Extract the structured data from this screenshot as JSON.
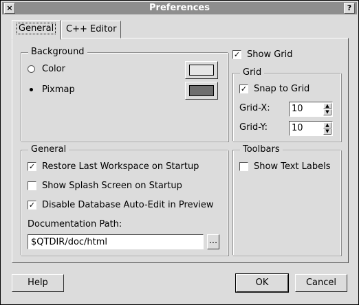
{
  "window": {
    "title": "Preferences",
    "close_glyph": "×",
    "help_glyph": "?"
  },
  "tabs": [
    {
      "label": "General",
      "active": true
    },
    {
      "label": "C++ Editor",
      "active": false
    }
  ],
  "background": {
    "title": "Background",
    "color_label": "Color",
    "pixmap_label": "Pixmap",
    "selected": "pixmap",
    "color_swatch": "#e6e6e6",
    "pixmap_swatch": "#6e6e6e"
  },
  "show_grid": {
    "label": "Show Grid",
    "checked": true
  },
  "grid": {
    "title": "Grid",
    "snap_label": "Snap to Grid",
    "snap_checked": true,
    "x_label": "Grid-X:",
    "x_value": "10",
    "y_label": "Grid-Y:",
    "y_value": "10"
  },
  "general": {
    "title": "General",
    "restore_label": "Restore Last Workspace on Startup",
    "restore_checked": true,
    "splash_label": "Show Splash Screen on Startup",
    "splash_checked": false,
    "disable_label": "Disable Database Auto-Edit in Preview",
    "disable_checked": true,
    "doc_path_label": "Documentation Path:",
    "doc_path_value": "$QTDIR/doc/html",
    "browse_label": "..."
  },
  "toolbars": {
    "title": "Toolbars",
    "text_labels_label": "Show Text Labels",
    "text_labels_checked": false
  },
  "buttons": {
    "help": "Help",
    "ok": "OK",
    "cancel": "Cancel"
  }
}
